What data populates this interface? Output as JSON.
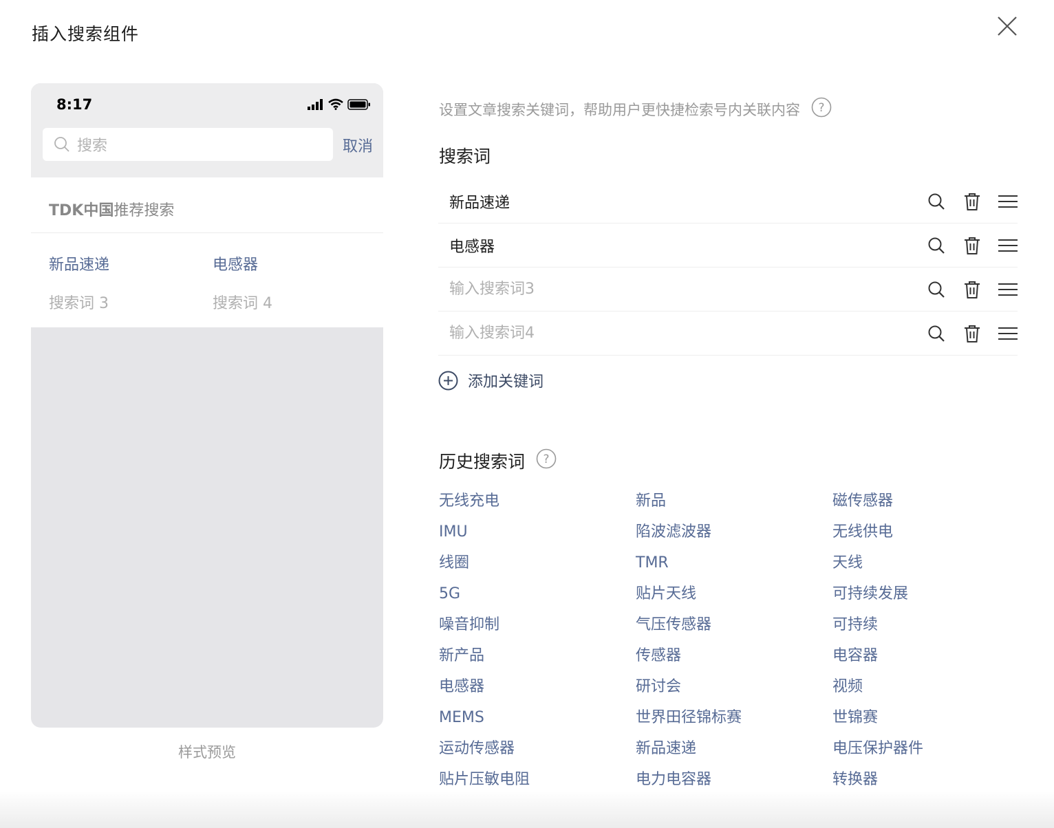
{
  "dialog": {
    "title": "插入搜索组件",
    "close_icon": "close-icon"
  },
  "preview": {
    "status_time": "8:17",
    "search_placeholder": "搜索",
    "cancel_label": "取消",
    "recommend_brand": "TDK中国",
    "recommend_suffix": "推荐搜索",
    "items": [
      "新品速递",
      "电感器",
      "搜索词 3",
      "搜索词 4"
    ],
    "caption": "样式预览"
  },
  "settings": {
    "hint": "设置文章搜索关键词，帮助用户更快捷检索号内关联内容",
    "keywords_title": "搜索词",
    "keywords": [
      {
        "value": "新品速递",
        "placeholder": ""
      },
      {
        "value": "电感器",
        "placeholder": ""
      },
      {
        "value": "",
        "placeholder": "输入搜索词3"
      },
      {
        "value": "",
        "placeholder": "输入搜索词4"
      }
    ],
    "add_label": "添加关键词",
    "history_title": "历史搜索词",
    "history": [
      "无线充电",
      "新品",
      "磁传感器",
      "IMU",
      "陷波滤波器",
      "无线供电",
      "线圈",
      "TMR",
      "天线",
      "5G",
      "贴片天线",
      "可持续发展",
      "噪音抑制",
      "气压传感器",
      "可持续",
      "新产品",
      "传感器",
      "电容器",
      "电感器",
      "研讨会",
      "视频",
      "MEMS",
      "世界田径锦标赛",
      "世锦赛",
      "运动传感器",
      "新品速递",
      "电压保护器件",
      "贴片压敏电阻",
      "电力电容器",
      "转换器"
    ]
  },
  "colors": {
    "link": "#576b95",
    "muted": "#9a9a9a",
    "placeholder": "#b0b0b0"
  }
}
